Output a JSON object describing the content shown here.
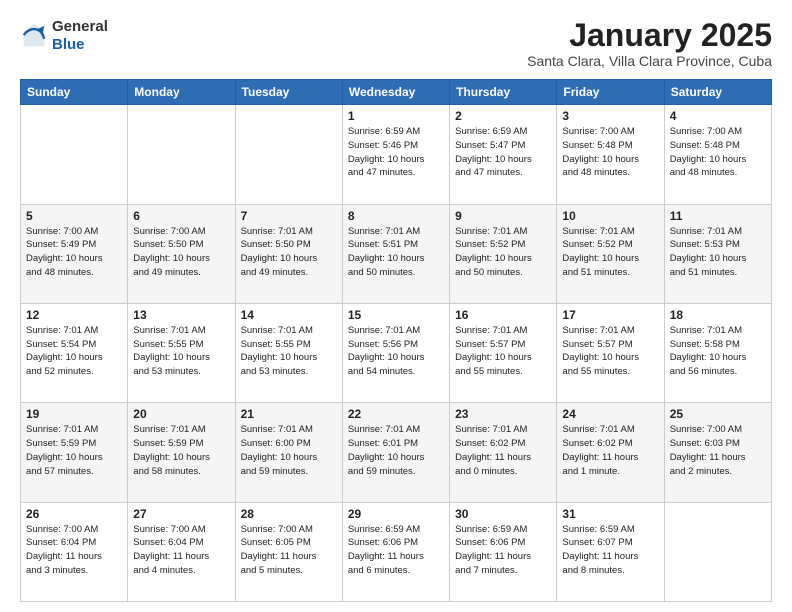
{
  "header": {
    "logo": {
      "line1": "General",
      "line2": "Blue"
    },
    "title": "January 2025",
    "subtitle": "Santa Clara, Villa Clara Province, Cuba"
  },
  "weekdays": [
    "Sunday",
    "Monday",
    "Tuesday",
    "Wednesday",
    "Thursday",
    "Friday",
    "Saturday"
  ],
  "weeks": [
    [
      {
        "day": "",
        "info": ""
      },
      {
        "day": "",
        "info": ""
      },
      {
        "day": "",
        "info": ""
      },
      {
        "day": "1",
        "info": "Sunrise: 6:59 AM\nSunset: 5:46 PM\nDaylight: 10 hours\nand 47 minutes."
      },
      {
        "day": "2",
        "info": "Sunrise: 6:59 AM\nSunset: 5:47 PM\nDaylight: 10 hours\nand 47 minutes."
      },
      {
        "day": "3",
        "info": "Sunrise: 7:00 AM\nSunset: 5:48 PM\nDaylight: 10 hours\nand 48 minutes."
      },
      {
        "day": "4",
        "info": "Sunrise: 7:00 AM\nSunset: 5:48 PM\nDaylight: 10 hours\nand 48 minutes."
      }
    ],
    [
      {
        "day": "5",
        "info": "Sunrise: 7:00 AM\nSunset: 5:49 PM\nDaylight: 10 hours\nand 48 minutes."
      },
      {
        "day": "6",
        "info": "Sunrise: 7:00 AM\nSunset: 5:50 PM\nDaylight: 10 hours\nand 49 minutes."
      },
      {
        "day": "7",
        "info": "Sunrise: 7:01 AM\nSunset: 5:50 PM\nDaylight: 10 hours\nand 49 minutes."
      },
      {
        "day": "8",
        "info": "Sunrise: 7:01 AM\nSunset: 5:51 PM\nDaylight: 10 hours\nand 50 minutes."
      },
      {
        "day": "9",
        "info": "Sunrise: 7:01 AM\nSunset: 5:52 PM\nDaylight: 10 hours\nand 50 minutes."
      },
      {
        "day": "10",
        "info": "Sunrise: 7:01 AM\nSunset: 5:52 PM\nDaylight: 10 hours\nand 51 minutes."
      },
      {
        "day": "11",
        "info": "Sunrise: 7:01 AM\nSunset: 5:53 PM\nDaylight: 10 hours\nand 51 minutes."
      }
    ],
    [
      {
        "day": "12",
        "info": "Sunrise: 7:01 AM\nSunset: 5:54 PM\nDaylight: 10 hours\nand 52 minutes."
      },
      {
        "day": "13",
        "info": "Sunrise: 7:01 AM\nSunset: 5:55 PM\nDaylight: 10 hours\nand 53 minutes."
      },
      {
        "day": "14",
        "info": "Sunrise: 7:01 AM\nSunset: 5:55 PM\nDaylight: 10 hours\nand 53 minutes."
      },
      {
        "day": "15",
        "info": "Sunrise: 7:01 AM\nSunset: 5:56 PM\nDaylight: 10 hours\nand 54 minutes."
      },
      {
        "day": "16",
        "info": "Sunrise: 7:01 AM\nSunset: 5:57 PM\nDaylight: 10 hours\nand 55 minutes."
      },
      {
        "day": "17",
        "info": "Sunrise: 7:01 AM\nSunset: 5:57 PM\nDaylight: 10 hours\nand 55 minutes."
      },
      {
        "day": "18",
        "info": "Sunrise: 7:01 AM\nSunset: 5:58 PM\nDaylight: 10 hours\nand 56 minutes."
      }
    ],
    [
      {
        "day": "19",
        "info": "Sunrise: 7:01 AM\nSunset: 5:59 PM\nDaylight: 10 hours\nand 57 minutes."
      },
      {
        "day": "20",
        "info": "Sunrise: 7:01 AM\nSunset: 5:59 PM\nDaylight: 10 hours\nand 58 minutes."
      },
      {
        "day": "21",
        "info": "Sunrise: 7:01 AM\nSunset: 6:00 PM\nDaylight: 10 hours\nand 59 minutes."
      },
      {
        "day": "22",
        "info": "Sunrise: 7:01 AM\nSunset: 6:01 PM\nDaylight: 10 hours\nand 59 minutes."
      },
      {
        "day": "23",
        "info": "Sunrise: 7:01 AM\nSunset: 6:02 PM\nDaylight: 11 hours\nand 0 minutes."
      },
      {
        "day": "24",
        "info": "Sunrise: 7:01 AM\nSunset: 6:02 PM\nDaylight: 11 hours\nand 1 minute."
      },
      {
        "day": "25",
        "info": "Sunrise: 7:00 AM\nSunset: 6:03 PM\nDaylight: 11 hours\nand 2 minutes."
      }
    ],
    [
      {
        "day": "26",
        "info": "Sunrise: 7:00 AM\nSunset: 6:04 PM\nDaylight: 11 hours\nand 3 minutes."
      },
      {
        "day": "27",
        "info": "Sunrise: 7:00 AM\nSunset: 6:04 PM\nDaylight: 11 hours\nand 4 minutes."
      },
      {
        "day": "28",
        "info": "Sunrise: 7:00 AM\nSunset: 6:05 PM\nDaylight: 11 hours\nand 5 minutes."
      },
      {
        "day": "29",
        "info": "Sunrise: 6:59 AM\nSunset: 6:06 PM\nDaylight: 11 hours\nand 6 minutes."
      },
      {
        "day": "30",
        "info": "Sunrise: 6:59 AM\nSunset: 6:06 PM\nDaylight: 11 hours\nand 7 minutes."
      },
      {
        "day": "31",
        "info": "Sunrise: 6:59 AM\nSunset: 6:07 PM\nDaylight: 11 hours\nand 8 minutes."
      },
      {
        "day": "",
        "info": ""
      }
    ]
  ]
}
